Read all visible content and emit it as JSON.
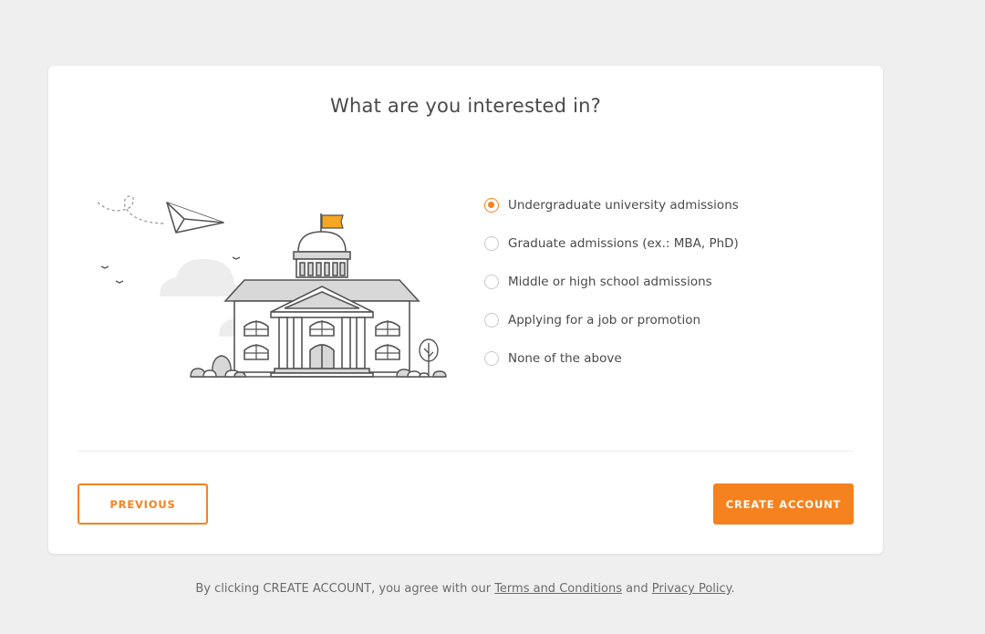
{
  "page": {
    "title": "What are you interested in?"
  },
  "options": [
    {
      "label": "Undergraduate university admissions",
      "selected": true
    },
    {
      "label": "Graduate admissions (ex.: MBA, PhD)",
      "selected": false
    },
    {
      "label": "Middle or high school admissions",
      "selected": false
    },
    {
      "label": "Applying for a job or promotion",
      "selected": false
    },
    {
      "label": "None of the above",
      "selected": false
    }
  ],
  "buttons": {
    "previous": "PREVIOUS",
    "create": "CREATE ACCOUNT"
  },
  "footer": {
    "prefix": "By clicking CREATE ACCOUNT, you agree with our ",
    "terms": "Terms and Conditions",
    "and": " and ",
    "privacy": "Privacy Policy",
    "suffix": "."
  },
  "colors": {
    "accent": "#f5821f",
    "background": "#efeff0",
    "card": "#ffffff"
  },
  "illustration": "school-building-with-paper-plane"
}
